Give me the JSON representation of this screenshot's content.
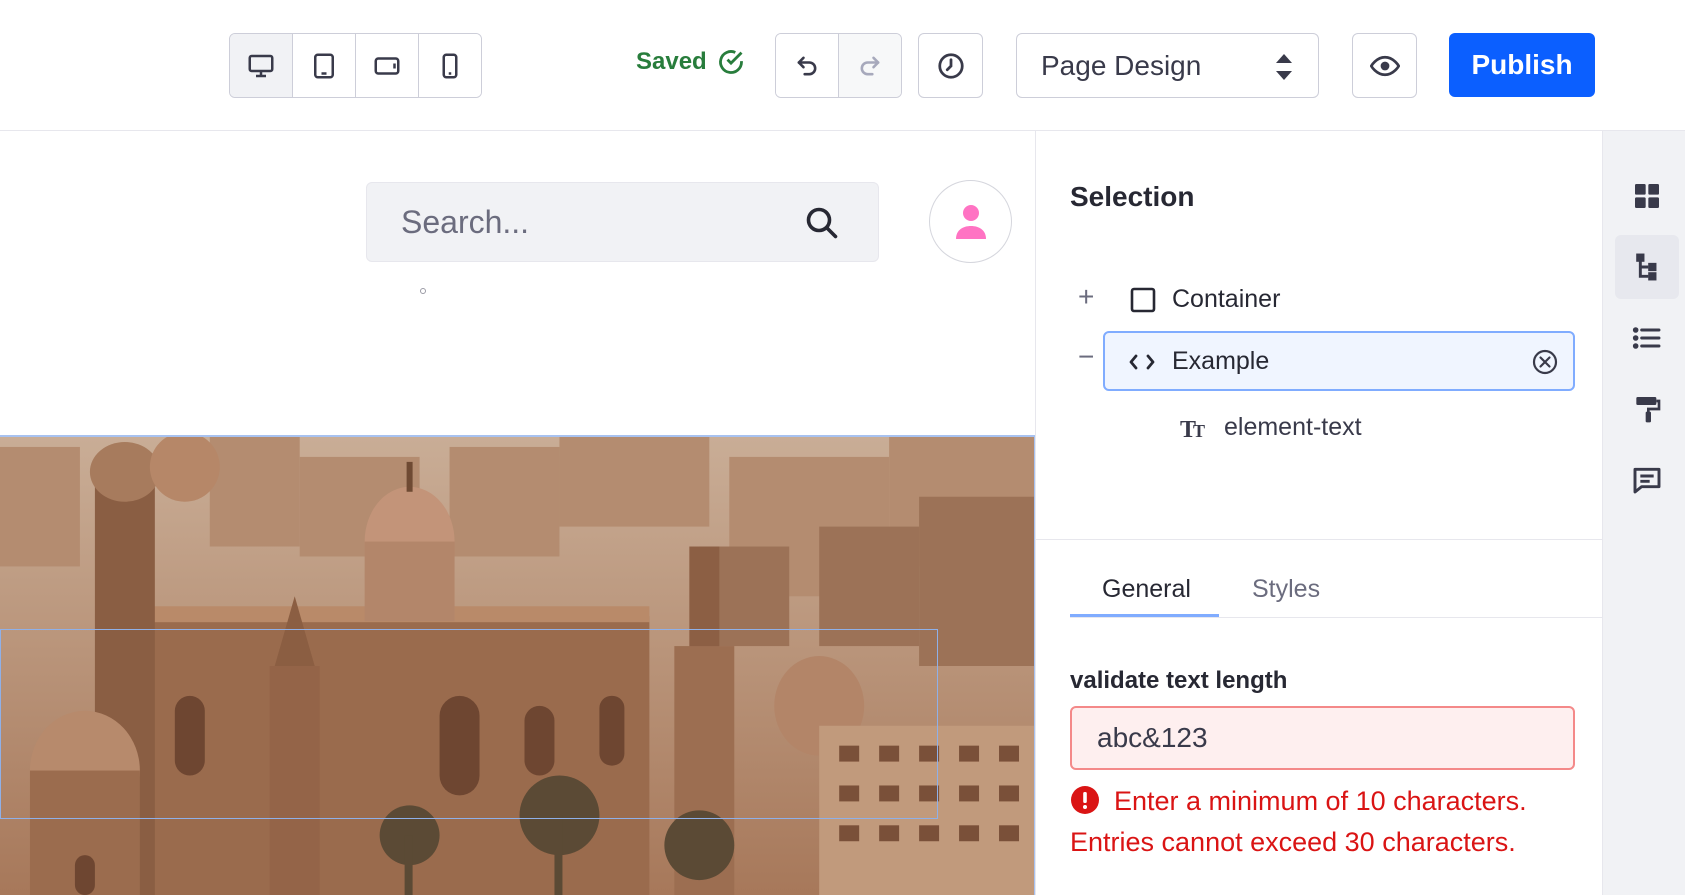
{
  "toolbar": {
    "devices": [
      "desktop",
      "tablet",
      "landscape",
      "mobile"
    ],
    "saved_label": "Saved",
    "page_select": "Page Design",
    "publish_label": "Publish"
  },
  "canvas": {
    "search_placeholder": "Search..."
  },
  "panel": {
    "title": "Selection",
    "tree": {
      "container": "Container",
      "example": "Example",
      "element_text": "element-text"
    },
    "tabs": [
      "General",
      "Styles"
    ],
    "field_label": "validate text length",
    "field_value": "abc&123",
    "error_1": "Enter a minimum of 10 characters.",
    "error_2": "Entries cannot exceed 30 characters."
  },
  "colors": {
    "primary": "#0b5fff",
    "success": "#287d3c",
    "danger": "#da1414",
    "avatar": "#ff73c3"
  }
}
